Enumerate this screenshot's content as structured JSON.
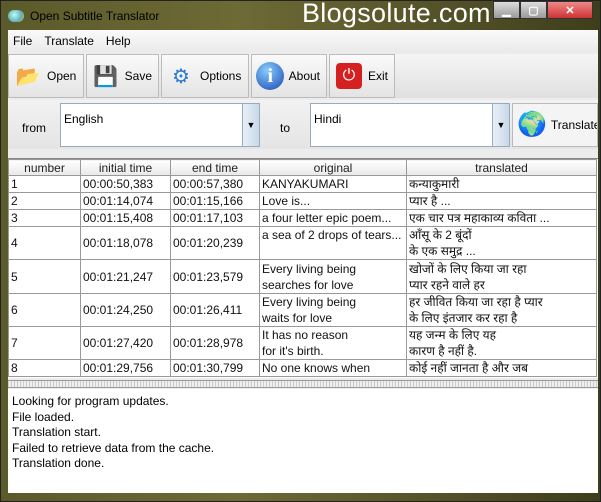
{
  "window": {
    "title": "Open Subtitle Translator",
    "watermark": "Blogsolute.com"
  },
  "menu": [
    "File",
    "Translate",
    "Help"
  ],
  "toolbar": {
    "open": "Open",
    "save": "Save",
    "options": "Options",
    "about": "About",
    "exit": "Exit"
  },
  "lang": {
    "from_label": "from",
    "from_value": "English",
    "to_label": "to",
    "to_value": "Hindi",
    "translate": "Translate"
  },
  "table": {
    "columns": [
      "number",
      "initial time",
      "end time",
      "original",
      "translated"
    ],
    "rows": [
      [
        "1",
        "00:00:50,383",
        "00:00:57,380",
        "KANYAKUMARI",
        "कन्याकुमारी"
      ],
      [
        "2",
        "00:01:14,074",
        "00:01:15,166",
        "Love is...",
        "प्यार है ..."
      ],
      [
        "3",
        "00:01:15,408",
        "00:01:17,103",
        "a four letter epic poem...",
        "एक चार पत्र महाकाव्य कविता ..."
      ],
      [
        "4",
        "00:01:18,078",
        "00:01:20,239",
        "a sea of 2 drops of tears...",
        "आँसू के 2 बूंदों\nके एक समुद्र ..."
      ],
      [
        "5",
        "00:01:21,247",
        "00:01:23,579",
        "Every living being\nsearches for love",
        "खोजों के लिए किया जा रहा\nप्यार रहने वाले हर"
      ],
      [
        "6",
        "00:01:24,250",
        "00:01:26,411",
        "Every living being\nwaits for love",
        "हर जीवित किया जा रहा है प्यार\nके लिए इंतजार कर रहा है"
      ],
      [
        "7",
        "00:01:27,420",
        "00:01:28,978",
        "It has no reason\nfor it's birth.",
        "यह जन्म के लिए यह\nकारण है नहीं है."
      ],
      [
        "8",
        "00:01:29,756",
        "00:01:30,799",
        "No one knows when",
        "कोई नहीं जानता है और जब"
      ]
    ]
  },
  "log": [
    "Looking for program updates.",
    "File loaded.",
    "Translation start.",
    "Failed to retrieve data from the cache.",
    "Translation done."
  ]
}
